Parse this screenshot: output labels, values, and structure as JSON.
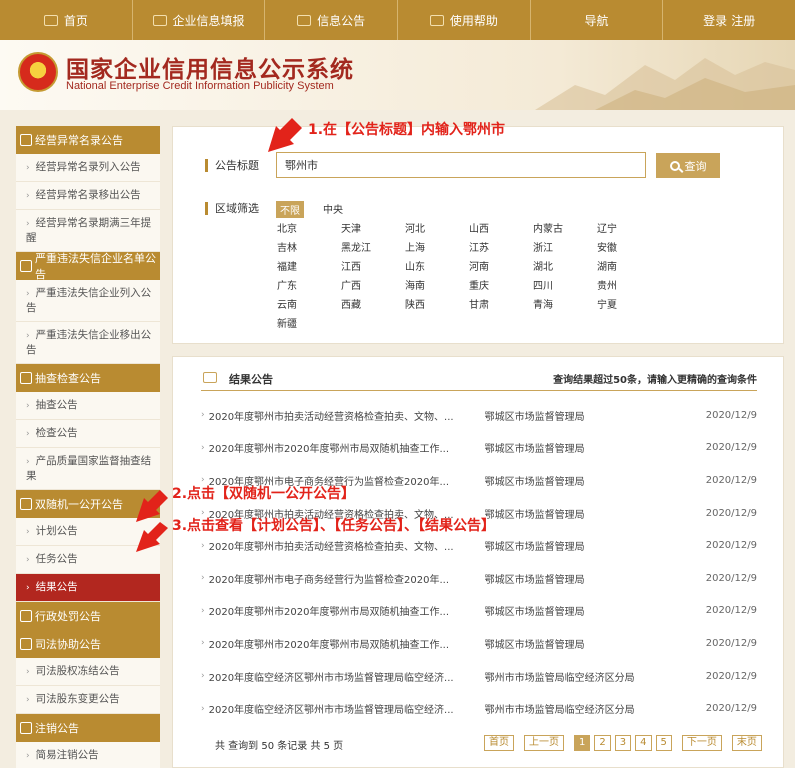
{
  "topnav": {
    "home": "首页",
    "enterprise_fill": "企业信息填报",
    "announcement": "信息公告",
    "help": "使用帮助",
    "guide": "导航",
    "login": "登录",
    "register": "注册"
  },
  "header": {
    "title": "国家企业信用信息公示系统",
    "subtitle": "National Enterprise Credit Information Publicity System"
  },
  "sidebar": {
    "sections": [
      {
        "title": "经营异常名录公告",
        "items": [
          "经营异常名录列入公告",
          "经营异常名录移出公告",
          "经营异常名录期满三年提醒"
        ]
      },
      {
        "title": "严重违法失信企业名单公告",
        "items": [
          "严重违法失信企业列入公告",
          "严重违法失信企业移出公告"
        ]
      },
      {
        "title": "抽查检查公告",
        "items": [
          "抽查公告",
          "检查公告",
          "产品质量国家监督抽查结果"
        ]
      },
      {
        "title": "双随机一公开公告",
        "items": [
          "计划公告",
          "任务公告",
          "结果公告"
        ]
      },
      {
        "title": "行政处罚公告",
        "items": []
      },
      {
        "title": "司法协助公告",
        "items": [
          "司法股权冻结公告",
          "司法股东变更公告"
        ]
      },
      {
        "title": "注销公告",
        "items": [
          "简易注销公告"
        ]
      }
    ]
  },
  "search": {
    "title_label": "公告标题",
    "title_value": "鄂州市",
    "button": "查询",
    "region_label": "区域筛选",
    "region_all": "不限",
    "region_central": "中央",
    "regions": [
      "北京",
      "天津",
      "河北",
      "山西",
      "内蒙古",
      "辽宁",
      "吉林",
      "黑龙江",
      "上海",
      "江苏",
      "浙江",
      "安徽",
      "福建",
      "江西",
      "山东",
      "河南",
      "湖北",
      "湖南",
      "广东",
      "广西",
      "海南",
      "重庆",
      "四川",
      "贵州",
      "云南",
      "西藏",
      "陕西",
      "甘肃",
      "青海",
      "宁夏",
      "新疆"
    ]
  },
  "annotations": {
    "step1": "1.在【公告标题】内输入鄂州市",
    "step2": "2.点击【双随机一公开公告】",
    "step3": "3.点击查看【计划公告】、【任务公告】、【结果公告】"
  },
  "results": {
    "title": "结果公告",
    "note": "查询结果超过50条，请输入更精确的查询条件",
    "rows": [
      {
        "title": "2020年度鄂州市拍卖活动经营资格检查拍卖、文物、...",
        "org": "鄂城区市场监督管理局",
        "date": "2020/12/9"
      },
      {
        "title": "2020年度鄂州市2020年度鄂州市局双随机抽查工作...",
        "org": "鄂城区市场监督管理局",
        "date": "2020/12/9"
      },
      {
        "title": "2020年度鄂州市电子商务经营行为监督检查2020年...",
        "org": "鄂城区市场监督管理局",
        "date": "2020/12/9"
      },
      {
        "title": "2020年度鄂州市拍卖活动经营资格检查拍卖、文物、...",
        "org": "鄂城区市场监督管理局",
        "date": "2020/12/9"
      },
      {
        "title": "2020年度鄂州市拍卖活动经营资格检查拍卖、文物、...",
        "org": "鄂城区市场监督管理局",
        "date": "2020/12/9"
      },
      {
        "title": "2020年度鄂州市电子商务经营行为监督检查2020年...",
        "org": "鄂城区市场监督管理局",
        "date": "2020/12/9"
      },
      {
        "title": "2020年度鄂州市2020年度鄂州市局双随机抽查工作...",
        "org": "鄂城区市场监督管理局",
        "date": "2020/12/9"
      },
      {
        "title": "2020年度鄂州市2020年度鄂州市局双随机抽查工作...",
        "org": "鄂城区市场监督管理局",
        "date": "2020/12/9"
      },
      {
        "title": "2020年度临空经济区鄂州市市场监督管理局临空经济...",
        "org": "鄂州市市场监管局临空经济区分局",
        "date": "2020/12/9"
      },
      {
        "title": "2020年度临空经济区鄂州市市场监督管理局临空经济...",
        "org": "鄂州市市场监管局临空经济区分局",
        "date": "2020/12/9"
      }
    ]
  },
  "pager": {
    "info": "共 查询到 50 条记录 共 5 页",
    "first": "首页",
    "prev": "上一页",
    "pages": [
      "1",
      "2",
      "3",
      "4",
      "5"
    ],
    "next": "下一页",
    "last": "末页"
  },
  "colors": {
    "gold": "#b98b31",
    "active_red": "#b2271f",
    "annotation_red": "#e2231a"
  }
}
